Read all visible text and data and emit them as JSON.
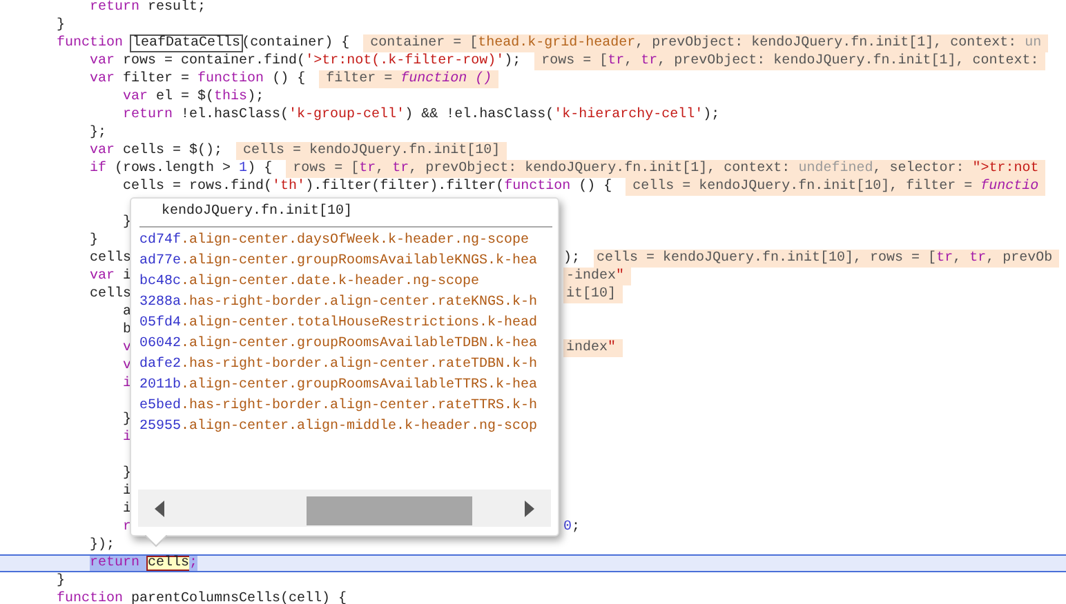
{
  "editor": {
    "lines": [
      {
        "left": [
          {
            "kind": "code",
            "text": "        return result;"
          }
        ]
      },
      {
        "left": [
          {
            "kind": "code",
            "text": "    }"
          }
        ]
      },
      {
        "left": [
          {
            "kind": "code",
            "text": "    function "
          },
          {
            "kind": "match",
            "text": "leafDataCells"
          },
          {
            "kind": "code",
            "text": "(container) {"
          },
          {
            "kind": "hint",
            "text": "container = [thead.k-grid-header, prevObject: kendoJQuery.fn.init[1], context: un"
          }
        ]
      },
      {
        "left": [
          {
            "kind": "code",
            "text": "        var rows = container.find('>tr:not(.k-filter-row)');"
          },
          {
            "kind": "hint",
            "text": "rows = [tr, tr, prevObject: kendoJQuery.fn.init[1], context:"
          }
        ]
      },
      {
        "left": [
          {
            "kind": "code",
            "text": "        var filter = function () {"
          },
          {
            "kind": "hint",
            "text": "filter = function ()"
          }
        ]
      },
      {
        "left": [
          {
            "kind": "code",
            "text": "            var el = $(this);"
          }
        ]
      },
      {
        "left": [
          {
            "kind": "code",
            "text": "            return !el.hasClass('k-group-cell') && !el.hasClass('k-hierarchy-cell');"
          }
        ]
      },
      {
        "left": [
          {
            "kind": "code",
            "text": "        };"
          }
        ]
      },
      {
        "left": [
          {
            "kind": "code",
            "text": "        var cells = $();"
          },
          {
            "kind": "hint",
            "text": "cells = kendoJQuery.fn.init[10]"
          }
        ]
      },
      {
        "left": [
          {
            "kind": "code",
            "text": "        if (rows.length > 1) {"
          },
          {
            "kind": "hint",
            "text": "rows = [tr, tr, prevObject: kendoJQuery.fn.init[1], context: undefined, selector: \">tr:not"
          }
        ]
      },
      {
        "left": [
          {
            "kind": "code",
            "text": "            cells = rows.find('th').filter(filter).filter(function () {"
          },
          {
            "kind": "hint",
            "text": "cells = kendoJQuery.fn.init[10], filter = functio"
          }
        ]
      },
      {
        "gap_before": true,
        "left": [
          {
            "kind": "code",
            "text": "            }"
          }
        ]
      },
      {
        "left": [
          {
            "kind": "code",
            "text": "        }"
          }
        ]
      },
      {
        "left": [
          {
            "kind": "code",
            "text": "        cells"
          }
        ],
        "right": [
          {
            "kind": "code",
            "text": ");"
          },
          {
            "kind": "hint",
            "text": "cells = kendoJQuery.fn.init[10], rows = [tr, tr, prevOb"
          }
        ]
      },
      {
        "left": [
          {
            "kind": "code",
            "text": "        var i"
          }
        ],
        "right": [
          {
            "kind": "hint",
            "text": "-index\""
          }
        ]
      },
      {
        "left": [
          {
            "kind": "code",
            "text": "        cells"
          }
        ],
        "right": [
          {
            "kind": "hint",
            "text": "it[10]"
          }
        ]
      },
      {
        "left": [
          {
            "kind": "code",
            "text": "            a"
          }
        ]
      },
      {
        "left": [
          {
            "kind": "code",
            "text": "            b"
          }
        ]
      },
      {
        "left": [
          {
            "kind": "keyword",
            "text": "            v"
          }
        ],
        "right": [
          {
            "kind": "hint",
            "text": "index\""
          }
        ]
      },
      {
        "left": [
          {
            "kind": "keyword",
            "text": "            v"
          }
        ]
      },
      {
        "left": [
          {
            "kind": "keyword",
            "text": "            i"
          }
        ]
      },
      {
        "gap_before": true,
        "left": [
          {
            "kind": "code",
            "text": "            }"
          }
        ]
      },
      {
        "left": [
          {
            "kind": "keyword",
            "text": "            i"
          }
        ]
      },
      {
        "gap_before": true,
        "left": [
          {
            "kind": "code",
            "text": "            }"
          }
        ]
      },
      {
        "left": [
          {
            "kind": "code",
            "text": "            i"
          }
        ]
      },
      {
        "left": [
          {
            "kind": "code",
            "text": "            i"
          }
        ]
      },
      {
        "left": [
          {
            "kind": "keyword",
            "text": "            r"
          }
        ],
        "right": [
          {
            "kind": "code",
            "text": "0;"
          }
        ]
      },
      {
        "left": [
          {
            "kind": "code",
            "text": "        });"
          }
        ]
      },
      {
        "current": true,
        "left": [
          {
            "kind": "selection",
            "text": "        return "
          },
          {
            "kind": "found",
            "text": "cells"
          },
          {
            "kind": "selection",
            "text": ";"
          }
        ]
      },
      {
        "current": false,
        "left": [
          {
            "kind": "code",
            "text": "    }"
          }
        ]
      },
      {
        "left": [
          {
            "kind": "code",
            "text": "    function parentColumnsCells(cell) {"
          }
        ]
      }
    ]
  },
  "popup": {
    "title": "kendoJQuery.fn.init[10]",
    "items": [
      {
        "prefix": "cd74f",
        "rest": ".align-center.daysOfWeek.k-header.ng-scope"
      },
      {
        "prefix": "ad77e",
        "rest": ".align-center.groupRoomsAvailableKNGS.k-hea"
      },
      {
        "prefix": "bc48c",
        "rest": ".align-center.date.k-header.ng-scope"
      },
      {
        "prefix": "3288a",
        "rest": ".has-right-border.align-center.rateKNGS.k-h"
      },
      {
        "prefix": "05fd4",
        "rest": ".align-center.totalHouseRestrictions.k-head"
      },
      {
        "prefix": "06042",
        "rest": ".align-center.groupRoomsAvailableTDBN.k-hea"
      },
      {
        "prefix": "dafe2",
        "rest": ".has-right-border.align-center.rateTDBN.k-h"
      },
      {
        "prefix": "2011b",
        "rest": ".align-center.groupRoomsAvailableTTRS.k-hea"
      },
      {
        "prefix": "e5bed",
        "rest": ".has-right-border.align-center.rateTTRS.k-h"
      },
      {
        "prefix": "25955",
        "rest": ".align-center.align-middle.k-header.ng-scop"
      }
    ]
  }
}
